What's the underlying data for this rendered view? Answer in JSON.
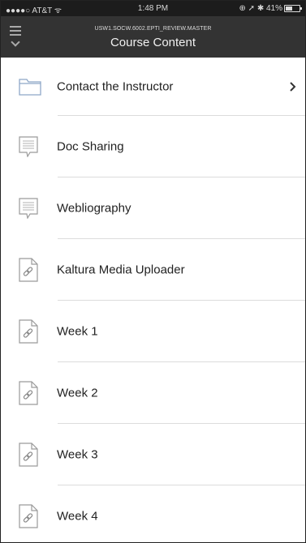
{
  "status_bar": {
    "carrier": "●●●●○ AT&T ᯤ",
    "time": "1:48 PM",
    "indicators": "⊕ ➚ ✱ 41%"
  },
  "nav": {
    "menu_icon": "hamburger-menu-icon",
    "course_code": "USW1.SOCW.6002.EPTI_REVIEW.MASTER",
    "title": "Course Content"
  },
  "items": [
    {
      "label": "Contact the Instructor",
      "icon": "folder-icon",
      "has_chevron": true
    },
    {
      "label": "Doc Sharing",
      "icon": "document-icon"
    },
    {
      "label": "Webliography",
      "icon": "document-icon"
    },
    {
      "label": "Kaltura Media Uploader",
      "icon": "link-document-icon"
    },
    {
      "label": "Week 1",
      "icon": "link-document-icon"
    },
    {
      "label": "Week 2",
      "icon": "link-document-icon"
    },
    {
      "label": "Week 3",
      "icon": "link-document-icon"
    },
    {
      "label": "Week 4",
      "icon": "link-document-icon"
    }
  ]
}
